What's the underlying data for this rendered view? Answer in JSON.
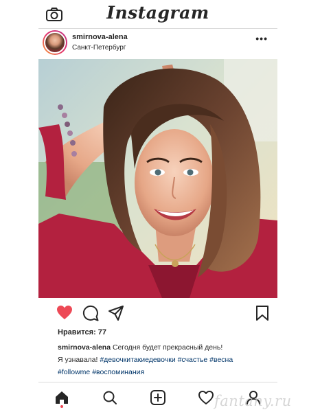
{
  "app": {
    "logo_text": "Instagram"
  },
  "post": {
    "username": "smirnova-alena",
    "location": "Санкт-Петербург",
    "more_label": "•••",
    "likes_label": "Нравится: 77",
    "caption_user": "smirnova-alena",
    "caption_text": "Сегодня будет прекрасный день!",
    "caption_line2": "Я узнавала!",
    "hashtags_line2": "#девочкитакиедевочки #счастье #весна",
    "hashtags_line3": "#followme #воспоминания"
  },
  "icons": {
    "top": [
      "camera-icon"
    ],
    "actions": [
      "heart-icon",
      "comment-icon",
      "share-icon",
      "bookmark-icon"
    ],
    "nav": [
      "home-icon",
      "search-icon",
      "add-icon",
      "activity-heart-icon",
      "profile-icon"
    ]
  },
  "colors": {
    "like": "#ed4956",
    "hashtag": "#003569",
    "text": "#262626",
    "divider": "#dbdbdb"
  },
  "watermark": "fantany.ru"
}
